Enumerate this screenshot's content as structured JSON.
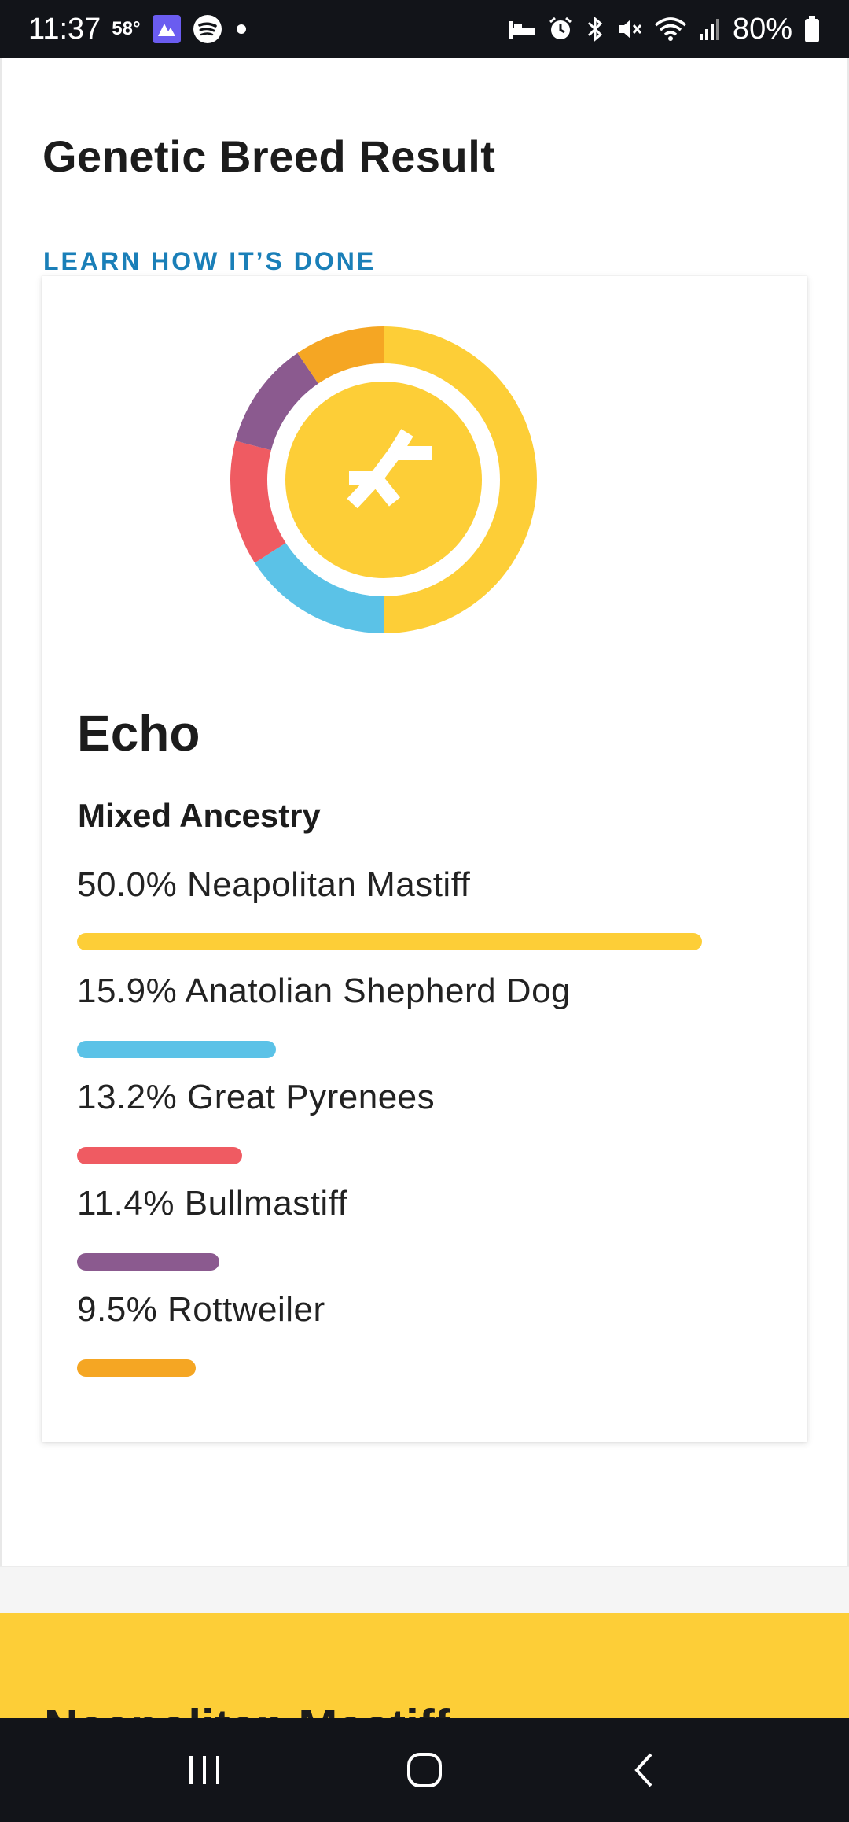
{
  "status_bar": {
    "time": "11:37",
    "temperature": "58°",
    "battery": "80%",
    "icons": [
      "gallery-app-icon",
      "spotify-icon",
      "dot-icon",
      "sleep-mode-icon",
      "alarm-icon",
      "bluetooth-icon",
      "mute-icon",
      "wifi-icon",
      "signal-icon",
      "battery-icon"
    ]
  },
  "header": {
    "title": "Genetic Breed Result",
    "learn_link": "LEARN HOW IT’S DONE"
  },
  "result": {
    "dog_name": "Echo",
    "ancestry_type": "Mixed Ancestry",
    "breeds": [
      {
        "label": "50.0% Neapolitan Mastiff",
        "percent": 50.0,
        "color": "#fdce37"
      },
      {
        "label": "15.9% Anatolian Shepherd Dog",
        "percent": 15.9,
        "color": "#5bc2e7"
      },
      {
        "label": "13.2% Great Pyrenees",
        "percent": 13.2,
        "color": "#ef5b62"
      },
      {
        "label": "11.4% Bullmastiff",
        "percent": 11.4,
        "color": "#8b5a8f"
      },
      {
        "label": "9.5% Rottweiler",
        "percent": 9.5,
        "color": "#f5a623"
      }
    ],
    "center_icon": "dna-branch-icon",
    "center_color": "#fdce37"
  },
  "next_section": {
    "heading": "Neapolitan Mastiff",
    "background": "#fdce37"
  },
  "nav_bar": {
    "buttons": [
      "recents-icon",
      "home-icon",
      "back-icon"
    ]
  }
}
